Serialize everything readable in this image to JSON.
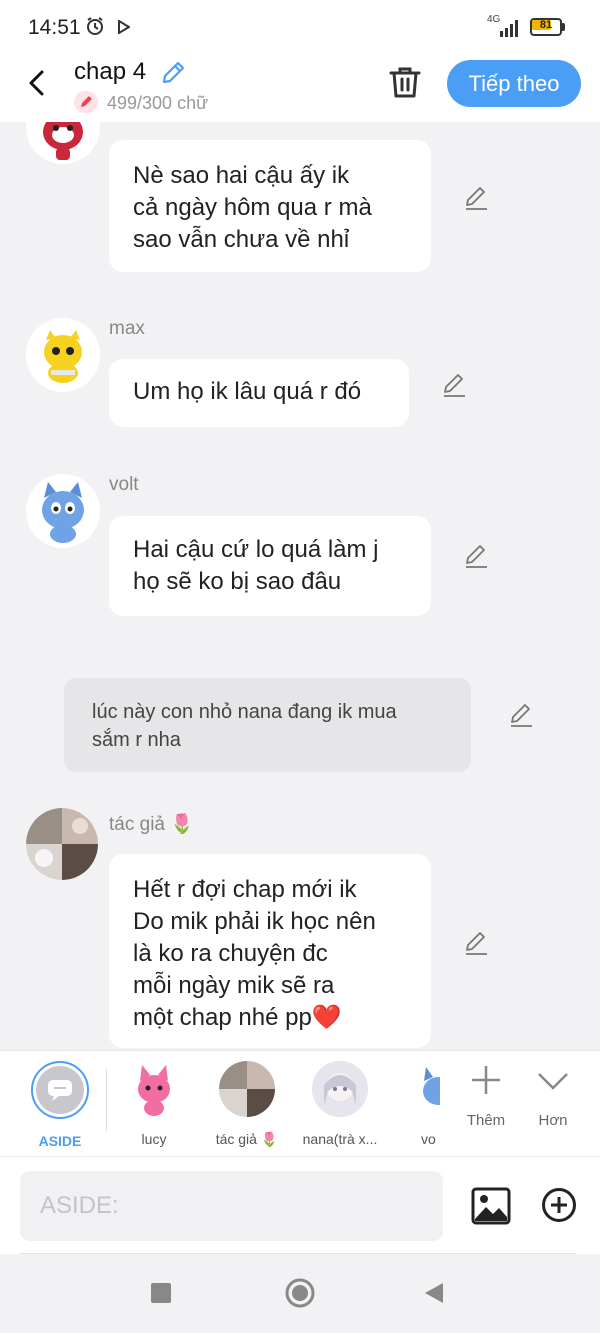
{
  "status_bar": {
    "time": "14:51",
    "network": "4G",
    "battery": "81",
    "battery_level": 0.81
  },
  "header": {
    "title": "chap 4",
    "counter": "499/300 chữ",
    "next_button": "Tiếp theo",
    "accent_color": "#4a9ef5"
  },
  "messages": [
    {
      "type": "bubble",
      "name": "",
      "lines": [
        "Nè sao hai cậu ấy ik",
        "cả ngày hôm qua r mà",
        "sao vẫn chưa về nhỉ"
      ]
    },
    {
      "type": "bubble",
      "name": "max",
      "lines": [
        "Um họ ik lâu quá r đó"
      ]
    },
    {
      "type": "bubble",
      "name": "volt",
      "lines": [
        "Hai cậu cứ lo quá làm j",
        "họ sẽ ko bị sao đâu"
      ]
    },
    {
      "type": "aside",
      "lines": [
        "lúc này con nhỏ nana đang ik mua",
        "sắm r nha"
      ]
    },
    {
      "type": "bubble",
      "name": "tác giả 🌷",
      "lines": [
        "Hết r đợi chap mới ik",
        "Do mik phải ik học nên",
        "là ko ra chuyện đc",
        "mỗi ngày mik sẽ ra",
        "một chap nhé pp❤️"
      ]
    }
  ],
  "characters": [
    {
      "label": "ASIDE"
    },
    {
      "label": "lucy"
    },
    {
      "label": "tác giả 🌷"
    },
    {
      "label": "nana(trà x..."
    },
    {
      "label": "vo"
    }
  ],
  "actions": {
    "add_label": "Thêm",
    "more_label": "Hơn"
  },
  "input": {
    "placeholder": "ASIDE:"
  }
}
